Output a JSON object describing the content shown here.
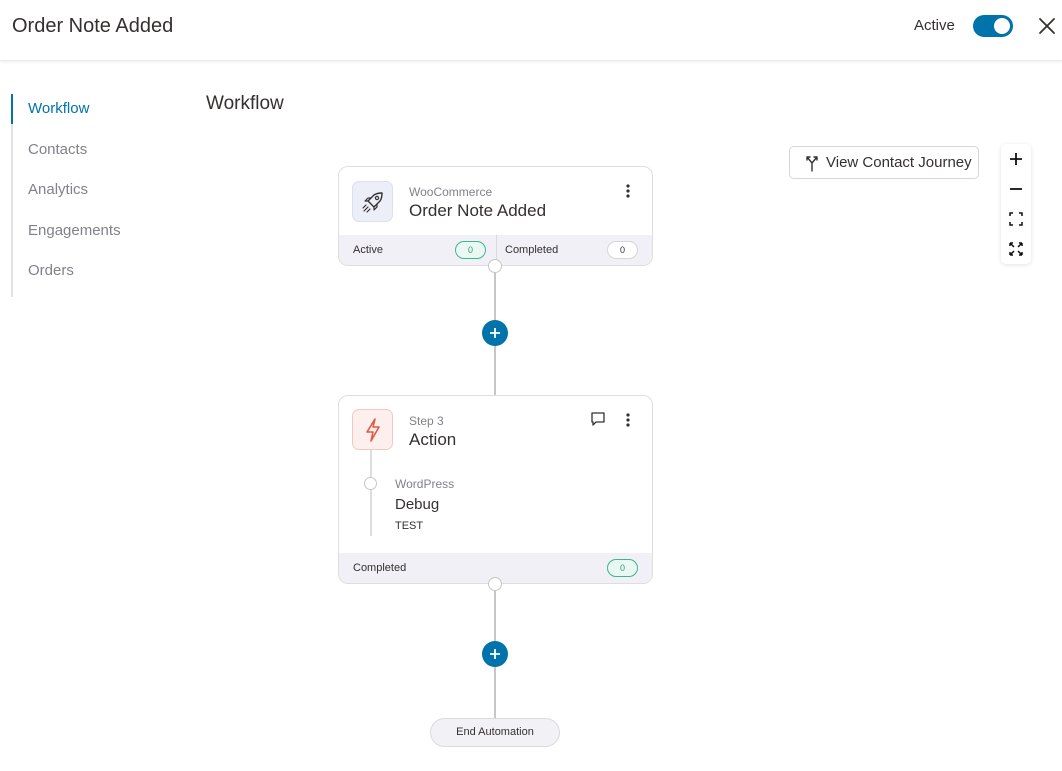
{
  "header": {
    "title": "Order Note Added",
    "active_label": "Active",
    "toggle_on": true,
    "close_icon": "close-icon"
  },
  "sidebar": {
    "items": [
      {
        "label": "Workflow",
        "active": true
      },
      {
        "label": "Contacts",
        "active": false
      },
      {
        "label": "Analytics",
        "active": false
      },
      {
        "label": "Engagements",
        "active": false
      },
      {
        "label": "Orders",
        "active": false
      }
    ]
  },
  "main": {
    "title": "Workflow",
    "journey_button": "View Contact Journey",
    "zoom": {
      "in_icon": "plus-icon",
      "out_icon": "minus-icon",
      "fit_icon": "fit-screen-icon",
      "fullscreen_icon": "fullscreen-icon"
    }
  },
  "trigger_card": {
    "source": "WooCommerce",
    "title": "Order Note Added",
    "icon": "rocket-icon",
    "active_label": "Active",
    "active_count": "0",
    "completed_label": "Completed",
    "completed_count": "0"
  },
  "action_card": {
    "step": "Step 3",
    "title": "Action",
    "icon": "lightning-icon",
    "integration": "WordPress",
    "action_name": "Debug",
    "action_detail": "TEST",
    "completed_label": "Completed",
    "completed_count": "0"
  },
  "end_label": "End Automation",
  "colors": {
    "accent": "#0073aa",
    "success": "#3cb68e",
    "action_icon": "#e05a44"
  }
}
